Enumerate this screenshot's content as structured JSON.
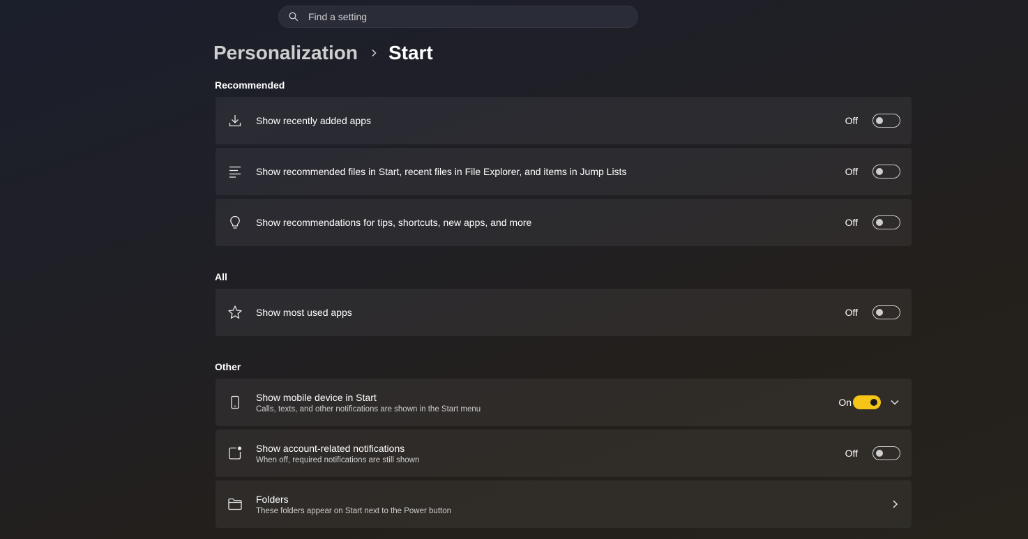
{
  "search": {
    "placeholder": "Find a setting",
    "icon": "search-icon"
  },
  "breadcrumb": {
    "parent": "Personalization",
    "current": "Start"
  },
  "sections": {
    "recommended": "Recommended",
    "all": "All",
    "other": "Other"
  },
  "settings": {
    "recently_added": {
      "label": "Show recently added apps",
      "state": "Off",
      "icon": "download-icon"
    },
    "recommended_files": {
      "label": "Show recommended files in Start, recent files in File Explorer, and items in Jump Lists",
      "state": "Off",
      "icon": "list-icon"
    },
    "tips": {
      "label": "Show recommendations for tips, shortcuts, new apps, and more",
      "state": "Off",
      "icon": "lightbulb-icon"
    },
    "most_used": {
      "label": "Show most used apps",
      "state": "Off",
      "icon": "star-icon"
    },
    "mobile_device": {
      "label": "Show mobile device in Start",
      "description": "Calls, texts, and other notifications are shown in the Start menu",
      "state": "On",
      "icon": "phone-icon"
    },
    "account_notifications": {
      "label": "Show account-related notifications",
      "description": "When off, required notifications are still shown",
      "state": "Off",
      "icon": "notification-badge-icon"
    },
    "folders": {
      "label": "Folders",
      "description": "These folders appear on Start next to the Power button",
      "icon": "folder-icon"
    }
  },
  "colors": {
    "accent": "#f5c518",
    "card_bg": "#2b2925",
    "text": "#ffffff"
  }
}
